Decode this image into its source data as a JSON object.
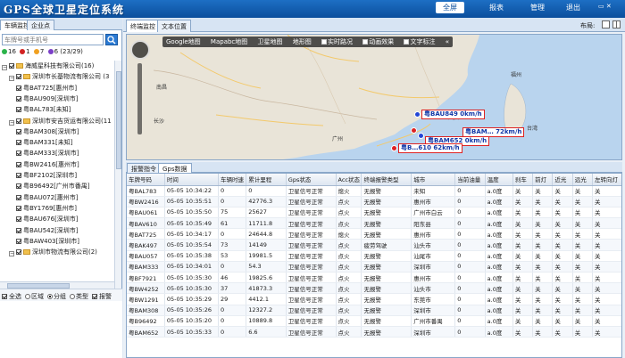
{
  "header": {
    "title": "GPS全球卫星定位系统",
    "nav": [
      "全屏",
      "报表",
      "管理",
      "退出"
    ]
  },
  "left": {
    "tabs": [
      "车辆监控",
      "企业点"
    ],
    "search_placeholder": "车牌号或手机号",
    "status": {
      "online": "16",
      "alarm": "1",
      "offline": "7",
      "count": "6",
      "total": "(23/29)"
    },
    "tree": [
      {
        "level": 0,
        "label": "海威星科技有限公司(16)",
        "type": "org"
      },
      {
        "level": 1,
        "label": "深圳市长基物流有限公司 (3",
        "type": "org"
      },
      {
        "level": 2,
        "label": "粤BAT725[惠州市]",
        "type": "car"
      },
      {
        "level": 2,
        "label": "粤BAU909[深圳市]",
        "type": "car"
      },
      {
        "level": 2,
        "label": "粤BAL783[未知]",
        "type": "car"
      },
      {
        "level": 1,
        "label": "深圳市安吉货运有限公司(11",
        "type": "org"
      },
      {
        "level": 2,
        "label": "粤BAM308[深圳市]",
        "type": "car"
      },
      {
        "level": 2,
        "label": "粤BAM331[未知]",
        "type": "car"
      },
      {
        "level": 2,
        "label": "粤BAM333[深圳市]",
        "type": "car"
      },
      {
        "level": 2,
        "label": "粤BW2416[惠州市]",
        "type": "car"
      },
      {
        "level": 2,
        "label": "粤BF2102[深圳市]",
        "type": "car"
      },
      {
        "level": 2,
        "label": "粤B96492[广州市番禺]",
        "type": "car"
      },
      {
        "level": 2,
        "label": "粤BAU072[惠州市]",
        "type": "car"
      },
      {
        "level": 2,
        "label": "粤BY1769[惠州市]",
        "type": "car"
      },
      {
        "level": 2,
        "label": "粤BAU676[深圳市]",
        "type": "car"
      },
      {
        "level": 2,
        "label": "粤BAU542[深圳市]",
        "type": "car"
      },
      {
        "level": 2,
        "label": "粤BAW403[深圳市]",
        "type": "car"
      },
      {
        "level": 1,
        "label": "深圳市物流有限公司(2)",
        "type": "org"
      }
    ],
    "radios": [
      {
        "label": "全选",
        "kind": "check"
      },
      {
        "label": "区域",
        "kind": "radio",
        "on": false
      },
      {
        "label": "分组",
        "kind": "radio",
        "on": true
      },
      {
        "label": "类型",
        "kind": "radio",
        "on": false
      },
      {
        "label": "报警",
        "kind": "check"
      }
    ]
  },
  "right": {
    "tabs": [
      "终端监控",
      "文本位置"
    ],
    "layout_label": "布局:",
    "map": {
      "toolbar": [
        "Google地图",
        "Mapabc地图",
        "卫星地图",
        "地形图"
      ],
      "toggles": [
        "实时路况",
        "动画效果",
        "文字标注"
      ],
      "vehicles": [
        {
          "label": "粤BAU849 0km/h"
        },
        {
          "label": "粤BAM652 0km/h"
        },
        {
          "label": "粤BAM… 72km/h"
        },
        {
          "label": "粤B…610 62km/h"
        }
      ],
      "places": [
        "南昌",
        "长沙",
        "广州",
        "汕头",
        "福州",
        "台湾"
      ]
    },
    "data_tabs": [
      "报警指令",
      "Gps数据"
    ],
    "table": {
      "columns": [
        "车牌号码",
        "时间",
        "车辆时速",
        "累计里程",
        "Gps状态",
        "Acc状态",
        "终端报警类型",
        "城市",
        "当前油量",
        "温度",
        "刹车",
        "前灯",
        "近光",
        "远光",
        "左转向灯",
        "右转"
      ],
      "rows": [
        [
          "粤BAL783",
          "05-05 10:34:22",
          "0",
          "0",
          "卫星信号正常",
          "熄火",
          "无报警",
          "未知",
          "0",
          "a.0度",
          "关",
          "关",
          "关",
          "关",
          "关",
          "关"
        ],
        [
          "粤BW2416",
          "05-05 10:35:51",
          "0",
          "42776.3",
          "卫星信号正常",
          "点火",
          "无报警",
          "惠州市",
          "0",
          "a.0度",
          "关",
          "关",
          "关",
          "关",
          "关",
          "关"
        ],
        [
          "粤BAU061",
          "05-05 10:35:50",
          "75",
          "25627",
          "卫星信号正常",
          "点火",
          "无报警",
          "广州市白云",
          "0",
          "a.0度",
          "关",
          "关",
          "关",
          "关",
          "关",
          "关"
        ],
        [
          "粤BAV610",
          "05-05 10:35:49",
          "61",
          "11711.8",
          "卫星信号正常",
          "点火",
          "无报警",
          "阳东县",
          "0",
          "a.0度",
          "关",
          "关",
          "关",
          "关",
          "关",
          "关"
        ],
        [
          "粤BAT725",
          "05-05 10:34:17",
          "0",
          "24644.8",
          "卫星信号正常",
          "熄火",
          "无报警",
          "惠州市",
          "0",
          "a.0度",
          "关",
          "关",
          "关",
          "关",
          "关",
          "关"
        ],
        [
          "粤BAK497",
          "05-05 10:35:54",
          "73",
          "14149",
          "卫星信号正常",
          "点火",
          "疲劳驾驶",
          "汕头市",
          "0",
          "a.0度",
          "关",
          "关",
          "关",
          "关",
          "关",
          "关"
        ],
        [
          "粤BAU057",
          "05-05 10:35:38",
          "53",
          "19981.5",
          "卫星信号正常",
          "点火",
          "无报警",
          "汕尾市",
          "0",
          "a.0度",
          "关",
          "关",
          "关",
          "关",
          "关",
          "关"
        ],
        [
          "粤BAM333",
          "05-05 10:34:01",
          "0",
          "54.3",
          "卫星信号正常",
          "点火",
          "无报警",
          "深圳市",
          "0",
          "a.0度",
          "关",
          "关",
          "关",
          "关",
          "关",
          "关"
        ],
        [
          "粤BF7921",
          "05-05 10:35:30",
          "46",
          "19825.6",
          "卫星信号正常",
          "点火",
          "无报警",
          "惠州市",
          "0",
          "a.0度",
          "关",
          "关",
          "关",
          "关",
          "关",
          "关"
        ],
        [
          "粤BW4252",
          "05-05 10:35:30",
          "37",
          "41873.3",
          "卫星信号正常",
          "点火",
          "无报警",
          "汕头市",
          "0",
          "a.0度",
          "关",
          "关",
          "关",
          "关",
          "关",
          "关"
        ],
        [
          "粤BW1291",
          "05-05 10:35:29",
          "29",
          "4412.1",
          "卫星信号正常",
          "点火",
          "无报警",
          "东莞市",
          "0",
          "a.0度",
          "关",
          "关",
          "关",
          "关",
          "关",
          "关"
        ],
        [
          "粤BAM308",
          "05-05 10:35:26",
          "0",
          "12327.2",
          "卫星信号正常",
          "点火",
          "无报警",
          "深圳市",
          "0",
          "a.0度",
          "关",
          "关",
          "关",
          "关",
          "关",
          "关"
        ],
        [
          "粤B96492",
          "05-05 10:35:20",
          "0",
          "10889.8",
          "卫星信号正常",
          "点火",
          "无报警",
          "广州市番禺",
          "0",
          "a.0度",
          "关",
          "关",
          "关",
          "关",
          "关",
          "关"
        ],
        [
          "粤BAM652",
          "05-05 10:35:33",
          "0",
          "6.6",
          "卫星信号正常",
          "点火",
          "无报警",
          "深圳市",
          "0",
          "a.0度",
          "关",
          "关",
          "关",
          "关",
          "关",
          "关"
        ]
      ]
    }
  },
  "colors": {
    "brand": "#0b4e9c",
    "online": "#2bb34a",
    "alarm": "#d22222",
    "offline": "#f0a020",
    "other": "#7b3fc7"
  }
}
